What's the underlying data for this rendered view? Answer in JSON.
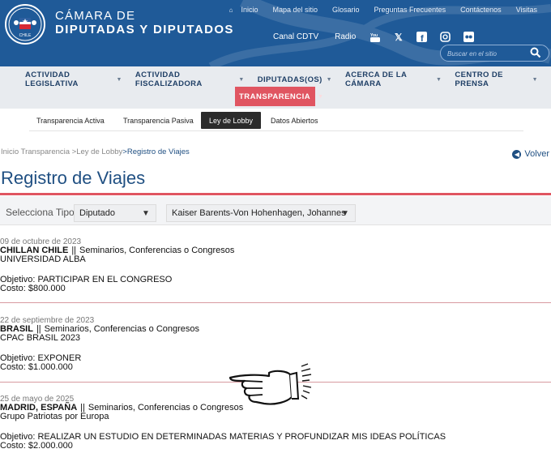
{
  "header": {
    "brand_line1": "CÁMARA DE",
    "brand_line2": "DIPUTADAS Y DIPUTADOS",
    "emblem_text": "CHILE",
    "top_links": [
      "Inicio",
      "Mapa del sitio",
      "Glosario",
      "Preguntas Frecuentes",
      "Contáctenos",
      "Visitas"
    ],
    "canal": "Canal CDTV",
    "radio": "Radio",
    "social_icons": [
      "youtube-icon",
      "x-icon",
      "facebook-icon",
      "instagram-icon",
      "flickr-icon"
    ],
    "search_placeholder": "Buscar en el sitio"
  },
  "mainnav": {
    "items": [
      "ACTIVIDAD LEGISLATIVA",
      "ACTIVIDAD FISCALIZADORA",
      "DIPUTADAS(OS)",
      "ACERCA DE LA CÁMARA",
      "CENTRO DE PRENSA"
    ],
    "active": "TRANSPARENCIA",
    "active_color": "#e05561"
  },
  "subtabs": {
    "items": [
      "Transparencia Activa",
      "Transparencia Pasiva",
      "Ley de Lobby",
      "Datos Abiertos"
    ],
    "selected": "Ley de Lobby"
  },
  "breadcrumb": {
    "home": "Inicio",
    "level1": "Transparencia",
    "level2": ">Ley de Lobby",
    "current": ">Registro de Viajes"
  },
  "back_label": "Volver",
  "page_title": "Registro de Viajes",
  "filters": {
    "label": "Selecciona Tipo",
    "type_value": "Diputado",
    "person_value": "Kaiser Barents-Von Hohenhagen, Johannes"
  },
  "trips": [
    {
      "date": "09 de octubre de 2023",
      "place": "CHILLAN CHILE",
      "separator": "||",
      "category": "Seminarios, Conferencias o Congresos",
      "organizer": "UNIVERSIDAD ALBA",
      "objective": "Objetivo: PARTICIPAR EN EL CONGRESO",
      "cost": "Costo:  $800.000"
    },
    {
      "date": "22 de septiembre de 2023",
      "place": "BRASIL",
      "separator": "||",
      "category": "Seminarios, Conferencias o Congresos",
      "organizer": "CPAC BRASIL 2023",
      "objective": "Objetivo: EXPONER",
      "cost": "Costo:  $1.000.000"
    },
    {
      "date": "25 de mayo de 2025",
      "place": "MADRID, ESPAÑA",
      "separator": "||",
      "category": "Seminarios, Conferencias o Congresos",
      "organizer": "Grupo Patriotas por Europa",
      "objective": "Objetivo: REALIZAR UN ESTUDIO EN DETERMINADAS MATERIAS Y PROFUNDIZAR MIS IDEAS POLÍTICAS",
      "cost": "Costo:  $2.000.000"
    }
  ]
}
